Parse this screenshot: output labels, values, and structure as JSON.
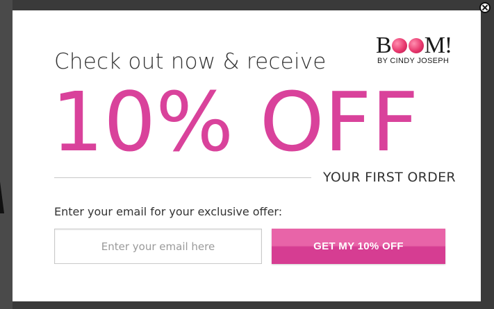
{
  "logo": {
    "wordmark_start": "B",
    "wordmark_end": "M!",
    "tagline": "BY CINDY JOSEPH",
    "dot_color": "#e8386e"
  },
  "popup": {
    "headline": "Check out now & receive",
    "offer": "10% OFF",
    "subhead": "YOUR FIRST ORDER",
    "prompt": "Enter your email for your exclusive offer:",
    "email_placeholder": "Enter your email here",
    "email_value": "",
    "cta_label": "GET MY 10% OFF",
    "close_icon": "close-icon"
  },
  "colors": {
    "accent": "#d9429b",
    "button_top": "#e864a8",
    "button_bottom": "#d63d92",
    "overlay": "#3a3a3a"
  }
}
